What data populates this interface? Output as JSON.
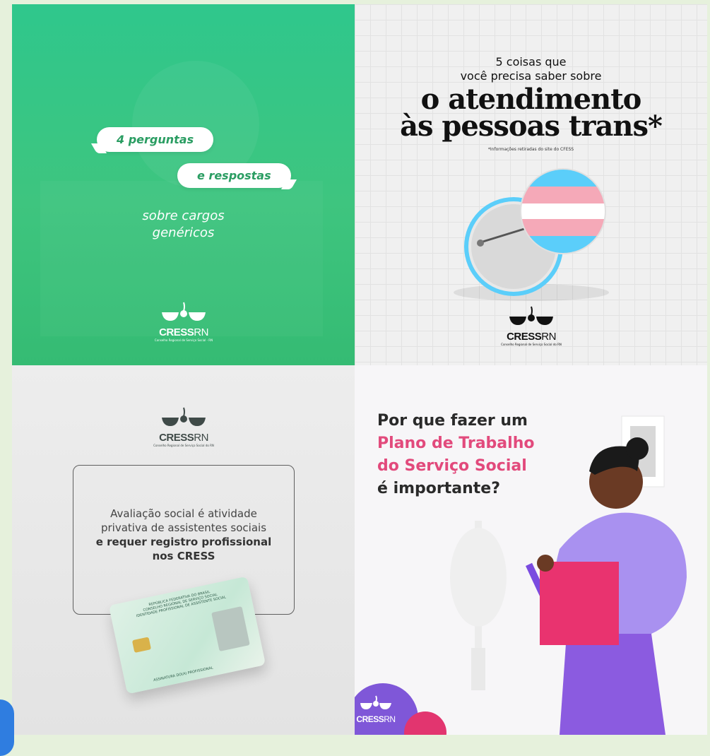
{
  "tiles": [
    {
      "bubble1": "4 perguntas",
      "bubble2": "e respostas",
      "subtitle_line1": "sobre cargos",
      "subtitle_line2": "genéricos",
      "logo": {
        "name": "CRESS",
        "suffix": "RN",
        "tag": "Conselho Regional de Serviço Social - RN"
      }
    },
    {
      "kicker_line1": "5 coisas que",
      "kicker_line2": "você precisa saber sobre",
      "headline_line1": "o atendimento",
      "headline_line2": "às pessoas trans*",
      "note": "*Informações retiradas do site do CFESS",
      "logo": {
        "name": "CRESS",
        "suffix": "RN",
        "tag": "Conselho Regional de Serviço Social do RN"
      }
    },
    {
      "logo": {
        "name": "CRESS",
        "suffix": "RN",
        "tag": "Conselho Regional de Serviço Social do RN"
      },
      "message_line1": "Avaliação social é atividade",
      "message_line2": "privativa de assistentes sociais",
      "message_bold1": "e requer registro profissional",
      "message_bold2": "nos CRESS",
      "card": {
        "line1": "REPÚBLICA FEDERATIVA DO BRASIL",
        "line2": "CONSELHO REGIONAL DE SERVIÇO SOCIAL",
        "line3": "IDENTIDADE PROFISSIONAL DE ASSISTENTE SOCIAL",
        "line4": "ASSINATURA DO(A) PROFISSIONAL"
      }
    },
    {
      "q_line1": "Por que fazer um",
      "q_pink1": "Plano de Trabalho",
      "q_pink2": "do Serviço Social",
      "q_line4": "é importante?",
      "logo": {
        "name": "CRESS",
        "suffix": "RN"
      }
    }
  ],
  "colors": {
    "green_bg": "#35c07c",
    "pink_accent": "#e24a7c",
    "purple": "#9b7de8",
    "trans_blue": "#5bcefa",
    "trans_pink": "#f5a9b8"
  }
}
